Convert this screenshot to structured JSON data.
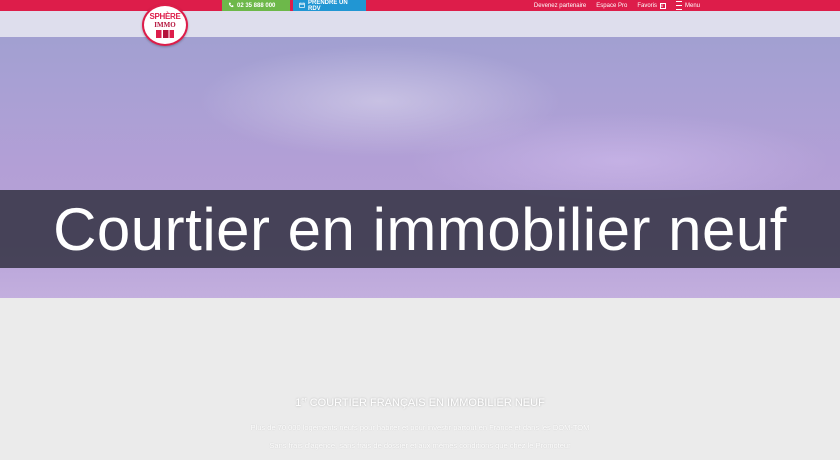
{
  "topbar": {
    "phone_label": "02 35 888 000",
    "rdv_label": "PRENDRE UN RDV",
    "links": {
      "partner": "Devenez partenaire",
      "pro": "Espace Pro",
      "favorites": "Favoris",
      "favorites_count": "0",
      "menu": "Menu"
    }
  },
  "logo": {
    "line1": "SPHÈRE",
    "line2": "IMMO"
  },
  "hero": {
    "title": "Courtier en immobilier neuf"
  },
  "intro": {
    "rank": "1",
    "rank_suffix": "er",
    "headline": " COURTIER FRANÇAIS EN IMMOBILIER NEUF",
    "line1": "Plus de 70 000 logements neufs pour habiter et pour investir partout en France et dans les DOM-TOM",
    "line2": "Sans frais d'agence, sans frais de dossier et aux mêmes conditions que chez le Promoteur"
  },
  "colors": {
    "brand": "#dd1d4a",
    "phone_button": "#6db84a",
    "rdv_button": "#2196d3"
  },
  "icons": {
    "phone": "phone-icon",
    "calendar": "calendar-icon",
    "menu": "hamburger-icon"
  }
}
